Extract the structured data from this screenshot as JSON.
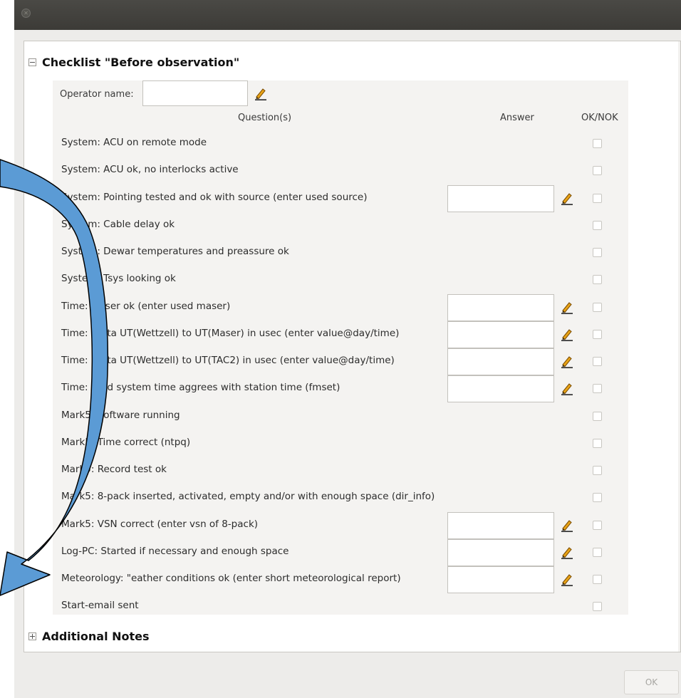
{
  "window": {
    "titlebar_icon": "close-icon"
  },
  "checklist": {
    "title": "Checklist \"Before observation\"",
    "operator_label": "Operator name:",
    "operator_value": "",
    "headers": {
      "question": "Question(s)",
      "answer": "Answer",
      "ok": "OK/NOK"
    },
    "rows": [
      {
        "question": "System: ACU on remote mode",
        "has_answer": false,
        "answer": "",
        "ok": false
      },
      {
        "question": "System: ACU ok, no interlocks active",
        "has_answer": false,
        "answer": "",
        "ok": false
      },
      {
        "question": "System: Pointing tested and ok with source (enter used source)",
        "has_answer": true,
        "answer": "",
        "ok": false
      },
      {
        "question": "System: Cable delay ok",
        "has_answer": false,
        "answer": "",
        "ok": false
      },
      {
        "question": "System: Dewar temperatures and preassure ok",
        "has_answer": false,
        "answer": "",
        "ok": false
      },
      {
        "question": "System: Tsys looking ok",
        "has_answer": false,
        "answer": "",
        "ok": false
      },
      {
        "question": "Time: Maser ok (enter used maser)",
        "has_answer": true,
        "answer": "",
        "ok": false
      },
      {
        "question": "Time: Delta UT(Wettzell) to UT(Maser) in usec (enter value@day/time)",
        "has_answer": true,
        "answer": "",
        "ok": false
      },
      {
        "question": "Time: Delta UT(Wettzell) to UT(TAC2) in usec (enter value@day/time)",
        "has_answer": true,
        "answer": "",
        "ok": false
      },
      {
        "question": "Time: Field system time aggrees with station time (fmset)",
        "has_answer": true,
        "answer": "",
        "ok": false
      },
      {
        "question": "Mark5: Software running",
        "has_answer": false,
        "answer": "",
        "ok": false
      },
      {
        "question": "Mark5: Time correct (ntpq)",
        "has_answer": false,
        "answer": "",
        "ok": false
      },
      {
        "question": "Mark5: Record test ok",
        "has_answer": false,
        "answer": "",
        "ok": false
      },
      {
        "question": "Mark5: 8-pack inserted, activated, empty and/or with enough space (dir_info)",
        "has_answer": false,
        "answer": "",
        "ok": false
      },
      {
        "question": "Mark5: VSN correct (enter vsn of 8-pack)",
        "has_answer": true,
        "answer": "",
        "ok": false
      },
      {
        "question": "Log-PC: Started if necessary and enough space",
        "has_answer": true,
        "answer": "",
        "ok": false
      },
      {
        "question": "Meteorology: \"eather conditions ok (enter short meteorological report)",
        "has_answer": true,
        "answer": "",
        "ok": false
      },
      {
        "question": "Start-email sent",
        "has_answer": false,
        "answer": "",
        "ok": false
      }
    ]
  },
  "notes": {
    "title": "Additional Notes"
  },
  "buttons": {
    "ok_label": "OK"
  },
  "overlay": {
    "arrow_color": "#5b9bd5",
    "arrow_outline": "#000000",
    "arrow_icon": "curved-arrow-icon"
  },
  "colors": {
    "pencil_color": "#e8a317"
  }
}
